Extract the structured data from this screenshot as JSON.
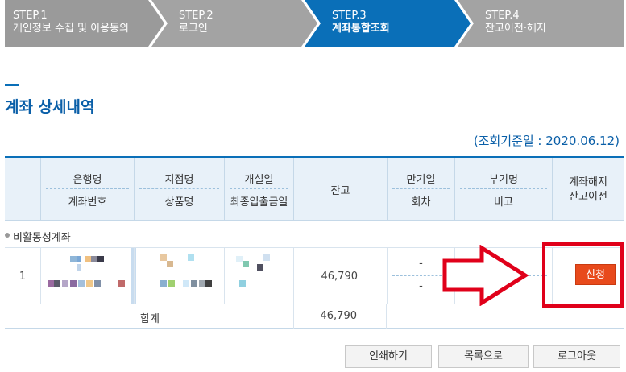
{
  "steps": [
    {
      "no": "STEP.1",
      "label": "개인정보 수집 및 이용동의"
    },
    {
      "no": "STEP.2",
      "label": "로그인"
    },
    {
      "no": "STEP.3",
      "label": "계좌통합조회"
    },
    {
      "no": "STEP.4",
      "label": "잔고이전·해지"
    }
  ],
  "page_title": "계좌 상세내역",
  "base_date": "(조회기준일 : 2020.06.12)",
  "table": {
    "headers": {
      "bank": "은행명",
      "account_no": "계좌번호",
      "branch": "지점명",
      "product": "상품명",
      "opened": "개설일",
      "last_deposit": "최종입출금일",
      "balance": "잔고",
      "maturity": "만기일",
      "round": "회차",
      "sub_name": "부기명",
      "note": "비고",
      "action_line1": "계좌해지",
      "action_line2": "잔고이전"
    },
    "group_label": "비활동성계좌",
    "row": {
      "no": "1",
      "balance": "46,790",
      "maturity": "-",
      "round": "-",
      "action_button": "신청"
    },
    "total_label": "합계",
    "total_amount": "46,790"
  },
  "buttons": {
    "print": "인쇄하기",
    "list": "목록으로",
    "logout": "로그아웃"
  },
  "colors": {
    "accent": "#0a6fb8",
    "step_inactive": "#a3a3a3",
    "apply_button": "#e84a1c",
    "annotation_red": "#e0001a"
  }
}
